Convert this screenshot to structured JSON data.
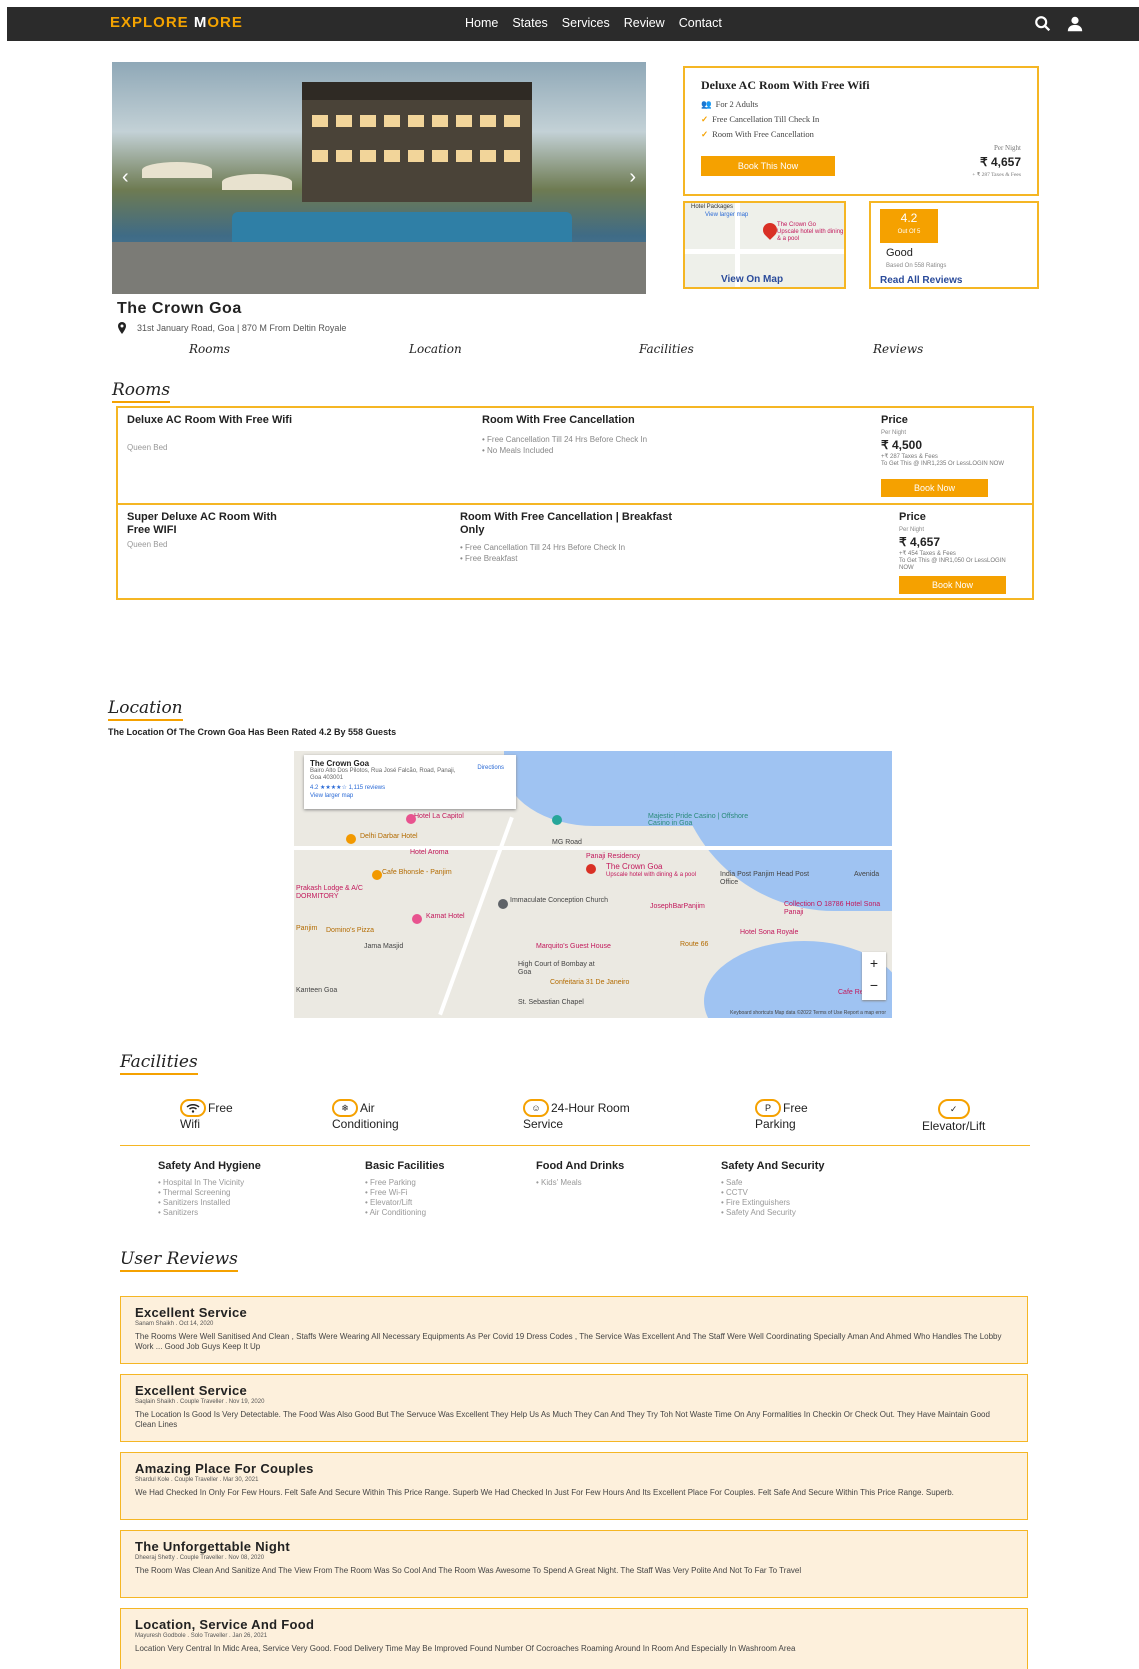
{
  "nav": {
    "logo_a": "EXPLORE ",
    "logo_m": "M",
    "logo_b": "ORE",
    "links": [
      "Home",
      "States",
      "Services",
      "Review",
      "Contact"
    ]
  },
  "booking": {
    "title": "Deluxe AC Room With Free Wifi",
    "features": [
      "For 2 Adults",
      "Free Cancellation Till Check In",
      "Room With Free Cancellation"
    ],
    "button": "Book This Now",
    "per_night": "Per Night",
    "price": "₹ 4,657",
    "taxes": "+ ₹ 287 Taxes & Fees"
  },
  "mini_map": {
    "hotel_packages": "Hotel Packages",
    "view_larger": "View larger map",
    "pin_label": "The Crown Go",
    "pin_sub": "Upscale hotel with dining & a pool",
    "link": "View On Map"
  },
  "rating": {
    "score": "4.2",
    "out_of": "Out Of 5",
    "grade": "Good",
    "based_on": "Based On 558 Ratings",
    "link": "Read All Reviews"
  },
  "hotel": {
    "name": "The Crown Goa",
    "address": "31st January Road, Goa | 870 M From Deltin Royale"
  },
  "tabs": [
    "Rooms",
    "Location",
    "Facilities",
    "Reviews"
  ],
  "rooms_section": {
    "heading": "Rooms",
    "rooms": [
      {
        "name": "Deluxe AC Room With Free Wifi",
        "bed": "Queen Bed",
        "plan": "Room With Free Cancellation",
        "features": [
          "Free Cancellation Till 24 Hrs Before Check In",
          "No Meals Included"
        ],
        "price_label": "Price",
        "per_night": "Per Night",
        "price": "₹ 4,500",
        "taxes": "+₹ 287 Taxes & Fees",
        "offer": "To Get This @ INR1,235 Or LessLOGIN NOW",
        "button": "Book Now"
      },
      {
        "name": "Super Deluxe AC Room With Free WIFI",
        "bed": "Queen Bed",
        "plan": "Room With Free Cancellation | Breakfast Only",
        "features": [
          "Free Cancellation Till 24 Hrs Before Check In",
          "Free Breakfast"
        ],
        "price_label": "Price",
        "per_night": "Per Night",
        "price": "₹ 4,657",
        "taxes": "+₹ 454 Taxes & Fees",
        "offer": "To Get This @ INR1,050 Or LessLOGIN NOW",
        "button": "Book Now"
      }
    ]
  },
  "location": {
    "heading": "Location",
    "subtitle": "The Location Of The Crown Goa Has Been Rated 4.2 By 558 Guests",
    "card_name": "The Crown Goa",
    "card_address": "Bairo Alto Dos Pilotos, Rua José Falcão, Road, Panaji, Goa 403001",
    "card_rating": "4.2 ★★★★☆  1,115 reviews",
    "card_larger": "View larger map",
    "card_directions": "Directions",
    "places": {
      "hotel_la_capitol": "Hotel La Capitol",
      "majestic": "Majestic Pride Casino | Offshore Casino in Goa",
      "delhi_darbar": "Delhi Darbar Hotel",
      "mg_road": "MG Road",
      "hotel_aroma": "Hotel Aroma",
      "panaji_residency": "Panaji Residency",
      "cafe_bhonsle": "Cafe Bhonsle - Panjim",
      "the_crown_goa": "The Crown Goa",
      "crown_sub": "Upscale hotel with dining & a pool",
      "india_post": "India Post Panjim Head Post Office",
      "avenida": "Avenida",
      "prakash": "Prakash Lodge & A/C DORMITORY",
      "immaculate": "Immaculate Conception Church",
      "joseph": "JosephBarPanjim",
      "collection": "Collection O 18786 Hotel Sona Panaji",
      "kamat": "Kamat Hotel",
      "panjim": "Panjim",
      "dominos": "Domino's Pizza",
      "hotel_sona_royale": "Hotel Sona Royale",
      "jama_masjid": "Jama Masjid",
      "marquitos": "Marquito's Guest House",
      "route66": "Route 66",
      "high_court": "High Court of Bombay at Goa",
      "confeitaria": "Confeitaria 31 De Janeiro",
      "kanteen": "Kanteen Goa",
      "st_sebastian": "St. Sebastian Chapel",
      "cafe_real": "Cafe Real"
    },
    "footer": "Keyboard shortcuts   Map data ©2022   Terms of Use   Report a map error"
  },
  "facilities": {
    "heading": "Facilities",
    "items": [
      {
        "icon": "wifi-icon",
        "top": "Free",
        "bottom": "Wifi"
      },
      {
        "icon": "ac-icon",
        "top": "Air",
        "bottom": "Conditioning"
      },
      {
        "icon": "room-service-icon",
        "top": "24-Hour Room",
        "bottom": "Service"
      },
      {
        "icon": "parking-icon",
        "top": "Free",
        "bottom": "Parking"
      },
      {
        "icon": "check-icon",
        "top": "",
        "bottom": "Elevator/Lift"
      }
    ],
    "categories": [
      {
        "title": "Safety And Hygiene",
        "items": [
          "Hospital In The Vicinity",
          "Thermal Screening",
          "Sanitizers Installed",
          "Sanitizers"
        ]
      },
      {
        "title": "Basic Facilities",
        "items": [
          "Free Parking",
          "Free Wi-Fi",
          "Elevator/Lift",
          "Air Conditioning"
        ]
      },
      {
        "title": "Food And Drinks",
        "items": [
          "Kids' Meals"
        ]
      },
      {
        "title": "Safety And Security",
        "items": [
          "Safe",
          "CCTV",
          "Fire Extinguishers",
          "Safety And Security"
        ]
      }
    ]
  },
  "reviews": {
    "heading": "User Reviews",
    "items": [
      {
        "title": "Excellent Service",
        "meta": "Sanam Shaikh . Oct 14, 2020",
        "text": "The Rooms Were Well Sanitised And Clean , Staffs Were Wearing All Necessary Equipments As Per Covid 19 Dress Codes , The Service Was Excellent And The Staff Were Well Coordinating Specially Aman And Ahmed Who Handles The Lobby Work ... Good Job Guys Keep It Up"
      },
      {
        "title": "Excellent Service",
        "meta": "Saqlain Shaikh . Couple Traveller . Nov 19, 2020",
        "text": "The Location Is Good Is Very Detectable. The Food Was Also Good But The Servuce Was Excellent They Help Us As Much They Can And They Try Toh Not Waste Time On Any Formalities In Checkin Or Check Out. They Have Maintain Good Clean Lines"
      },
      {
        "title": "Amazing Place For Couples",
        "meta": "Shardul Kole . Couple Traveller . Mar 30, 2021",
        "text": "We Had Checked In Only For Few Hours. Felt Safe And Secure Within This Price Range. Superb We Had Checked In Just For Few Hours And Its Excellent Place For Couples. Felt Safe And Secure Within This Price Range. Superb."
      },
      {
        "title": "The Unforgettable Night",
        "meta": "Dheeraj Shetty . Couple Traveller . Nov 08, 2020",
        "text": "The Room Was Clean And Sanitize And The View From The Room Was So Cool And The Room Was Awesome To Spend A Great Night. The Staff Was Very Polite And Not To Far To Travel"
      },
      {
        "title": "Location, Service And Food",
        "meta": "Mayuresh Godbole . Solo Traveller . Jan 26, 2021",
        "text": "Location Very Central In Midc Area, Service Very Good. Food Delivery Time May Be Improved Found Number Of Cocroaches Roaming Around In Room And Especially In Washroom Area"
      }
    ]
  }
}
